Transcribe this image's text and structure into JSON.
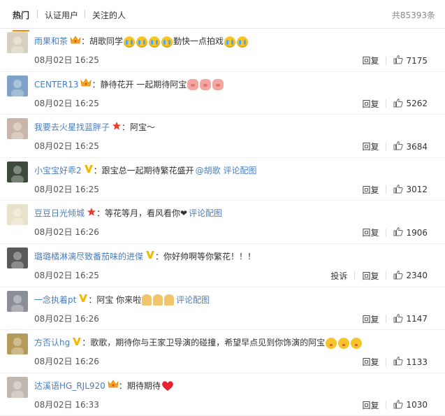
{
  "tabs": {
    "hot": "热门",
    "verified": "认证用户",
    "following": "关注的人"
  },
  "total_text": "共85393条",
  "actions": {
    "reply": "回复",
    "report": "投诉"
  },
  "colors": {
    "link": "#4a7dbd",
    "tab_underline": "#ff8200",
    "crown": "#f5a623",
    "star": "#e8402c",
    "vip_v": "#f5b800"
  },
  "comments": [
    {
      "user": "雨果和茶",
      "badge": "crown-icon",
      "text_before": "胡歌同学",
      "emojis_a": [
        "cry",
        "cry",
        "cry",
        "cry"
      ],
      "text_mid": "勤快一点拍戏",
      "emojis_b": [
        "cry",
        "cry"
      ],
      "link": "",
      "time": "08月02日 16:25",
      "likes": "7175",
      "avatar_color": "#d9cfbf"
    },
    {
      "user": "CENTER13",
      "badge": "crown-icon",
      "text_before": "静待花开 一起期待阿宝",
      "emojis_a": [
        "pig",
        "pig",
        "pig"
      ],
      "text_mid": "",
      "emojis_b": [],
      "link": "",
      "time": "08月02日 16:25",
      "likes": "5262",
      "avatar_color": "#7fa3c8"
    },
    {
      "user": "我要去火星找蓝胖子",
      "badge": "star-icon",
      "text_before": "阿宝～",
      "emojis_a": [],
      "text_mid": "",
      "emojis_b": [],
      "link": "",
      "time": "08月02日 16:25",
      "likes": "3684",
      "avatar_color": "#c9b6a8"
    },
    {
      "user": "小宝宝好乖2",
      "badge": "v-icon",
      "text_before": "跟宝总一起期待繁花盛开",
      "emojis_a": [],
      "text_mid": "",
      "emojis_b": [],
      "link": "@胡歌 评论配图",
      "time": "08月02日 16:25",
      "likes": "3012",
      "avatar_color": "#3b4a3a"
    },
    {
      "user": "豆豆日光倾城",
      "badge": "star-icon",
      "text_before": "等花等月，看风看你❤",
      "emojis_a": [],
      "text_mid": "",
      "emojis_b": [],
      "link": "评论配图",
      "time": "08月02日 16:26",
      "likes": "1906",
      "avatar_color": "#e8e3c8"
    },
    {
      "user": "璐璐橘淋漓尽致番茄味的进傑",
      "badge": "v-icon",
      "text_before": "你好帅啊等你繁花！！！",
      "emojis_a": [],
      "text_mid": "",
      "emojis_b": [],
      "link": "",
      "time": "08月02日 16:25",
      "likes": "2340",
      "avatar_color": "#5a5a5a",
      "report": true
    },
    {
      "user": "一念执着pt",
      "badge": "v-icon",
      "text_before": "阿宝 你来啦",
      "emojis_a": [
        "pray",
        "pray",
        "pray"
      ],
      "text_mid": "",
      "emojis_b": [],
      "link": "评论配图",
      "time": "08月02日 16:26",
      "likes": "1147",
      "avatar_color": "#8a8f96"
    },
    {
      "user": "方否认hg",
      "badge": "v-icon",
      "text_before": "歌歌，期待你与王家卫导演的碰撞，希望早点见到你饰演的阿宝",
      "emojis_a": [
        "kiss",
        "kiss",
        "kiss"
      ],
      "text_mid": "",
      "emojis_b": [],
      "link": "",
      "time": "08月02日 16:26",
      "likes": "1133",
      "avatar_color": "#b59a5a"
    },
    {
      "user": "达溪语HG_RJL920",
      "badge": "crown-icon",
      "text_before": "期待期待",
      "emojis_a": [
        "heart"
      ],
      "text_mid": "",
      "emojis_b": [],
      "link": "",
      "time": "08月02日 16:33",
      "likes": "1030",
      "avatar_color": "#c0b8ae"
    }
  ]
}
